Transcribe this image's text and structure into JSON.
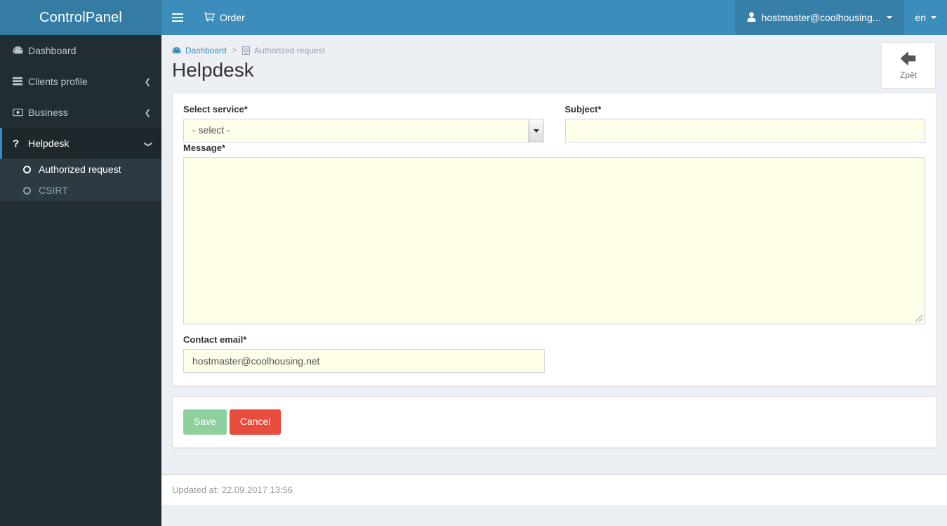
{
  "brand": {
    "title": "ControlPanel"
  },
  "navbar": {
    "toggle_icon": "hamburger-icon",
    "order_label": "Order",
    "order_icon": "shopping-cart-icon",
    "user_label": "hostmaster@coolhousing...",
    "user_icon": "user-icon",
    "lang_label": "en",
    "colors": {
      "navbar": "#3c8dbc",
      "logo": "#357ca5"
    }
  },
  "sidebar": {
    "items": [
      {
        "label": "Dashboard",
        "icon": "tachometer-icon",
        "arrow": "",
        "active": false
      },
      {
        "label": "Clients profile",
        "icon": "server-list-icon",
        "arrow": "chevron-left-icon",
        "active": false
      },
      {
        "label": "Business",
        "icon": "money-bill-icon",
        "arrow": "chevron-left-icon",
        "active": false
      },
      {
        "label": "Helpdesk",
        "icon": "question-icon",
        "arrow": "chevron-down-icon",
        "active": true
      }
    ],
    "submenu": [
      {
        "label": "Authorized request",
        "icon": "circle-o-icon",
        "active": true
      },
      {
        "label": "CSIRT",
        "icon": "circle-o-icon",
        "active": false
      }
    ],
    "colors": {
      "bg": "#222d32",
      "submenu_bg": "#2c3b41",
      "active_border": "#3c8dbc"
    }
  },
  "breadcrumb": {
    "home_label": "Dashboard",
    "home_icon": "tachometer-icon",
    "separator": ">",
    "current_label": "Authorized request",
    "current_icon": "building-icon"
  },
  "page": {
    "title": "Helpdesk",
    "back_button": {
      "label": "Zpět",
      "icon": "arrow-left-icon"
    }
  },
  "form": {
    "select_service": {
      "label": "Select service*",
      "value": "- select -",
      "options": [
        "- select -"
      ]
    },
    "subject": {
      "label": "Subject*",
      "value": "",
      "placeholder": ""
    },
    "message": {
      "label": "Message*",
      "value": "",
      "placeholder": ""
    },
    "contact_email": {
      "label": "Contact email*",
      "value": "hostmaster@coolhousing.net",
      "placeholder": ""
    }
  },
  "actions": {
    "save_label": "Save",
    "cancel_label": "Cancel",
    "save_color": "#8fd19e",
    "cancel_color": "#e74c3c"
  },
  "footer": {
    "updated_text": "Updated at: 22.09.2017 13:56"
  }
}
